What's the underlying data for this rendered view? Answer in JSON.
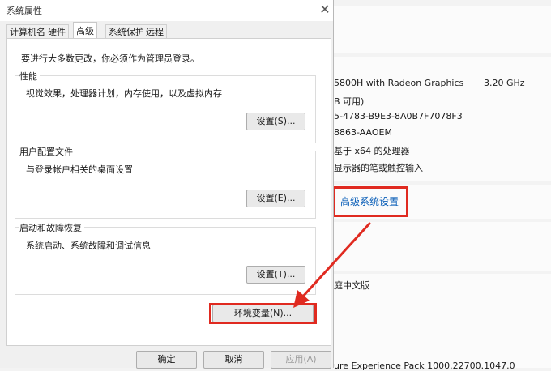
{
  "background": {
    "cpu": "5800H with Radeon Graphics",
    "cpu_speed": "3.20 GHz",
    "ram": "B 可用)",
    "device_id": "5-4783-B9E3-8A0B7F7078F3",
    "product_id": "8863-AAOEM",
    "system_type": "基于 x64 的处理器",
    "pen_touch": "显示器的笔或触控输入",
    "advanced_link": "高级系统设置",
    "edition": "庭中文版",
    "experience": "ure Experience Pack 1000.22700.1047.0"
  },
  "dialog": {
    "title": "系统属性",
    "tabs": [
      "计算机名",
      "硬件",
      "高级",
      "系统保护",
      "远程"
    ],
    "active_tab": "高级",
    "admin_note": "要进行大多数更改，你必须作为管理员登录。",
    "performance": {
      "label": "性能",
      "desc": "视觉效果，处理器计划，内存使用，以及虚拟内存",
      "button": "设置(S)..."
    },
    "profiles": {
      "label": "用户配置文件",
      "desc": "与登录帐户相关的桌面设置",
      "button": "设置(E)..."
    },
    "startup": {
      "label": "启动和故障恢复",
      "desc": "系统启动、系统故障和调试信息",
      "button": "设置(T)..."
    },
    "env_button": "环境变量(N)...",
    "ok": "确定",
    "cancel": "取消",
    "apply": "应用(A)"
  },
  "colors": {
    "highlight": "#e02a20",
    "link": "#0b5fb8"
  }
}
